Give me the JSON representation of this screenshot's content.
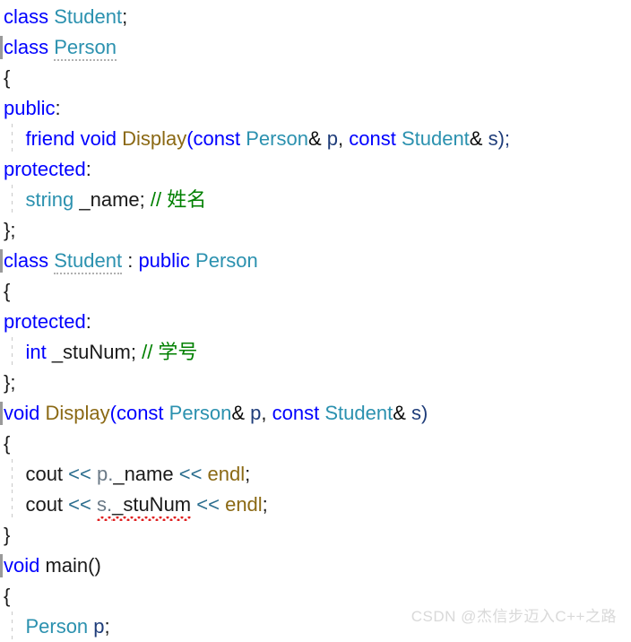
{
  "editor": {
    "language": "C++",
    "background_color": "#ffffff",
    "font_size_px": 22,
    "line_height_px": 34,
    "theme_colors": {
      "keyword": "#0000FF",
      "type": "#2B91AF",
      "function": "#8B6914",
      "comment": "#008000",
      "plain_text": "#1a1a1a",
      "parameter": "#1F3D7A",
      "object_qualifier": "#6b7a87",
      "stream_operator": "#2B6E8F",
      "error_squiggle": "#e02020",
      "indent_guide": "#c9c9c9",
      "margin_marker": "#9a9a9a"
    }
  },
  "code": {
    "lines": [
      {
        "n": 1,
        "marked": false,
        "guide": false,
        "tokens": [
          {
            "t": "class ",
            "c": "kw"
          },
          {
            "t": "Student",
            "c": "typ"
          },
          {
            "t": ";",
            "c": "plain"
          }
        ]
      },
      {
        "n": 2,
        "marked": true,
        "guide": false,
        "tokens": [
          {
            "t": "class ",
            "c": "kw"
          },
          {
            "t": "Person",
            "c": "typ",
            "dotted": true
          }
        ]
      },
      {
        "n": 3,
        "marked": false,
        "guide": false,
        "tokens": [
          {
            "t": "{",
            "c": "plain"
          }
        ]
      },
      {
        "n": 4,
        "marked": false,
        "guide": false,
        "tokens": [
          {
            "t": "public",
            "c": "kw"
          },
          {
            "t": ":",
            "c": "plain"
          }
        ]
      },
      {
        "n": 5,
        "marked": false,
        "guide": true,
        "tokens": [
          {
            "t": "    ",
            "c": "plain"
          },
          {
            "t": "friend void ",
            "c": "kw"
          },
          {
            "t": "Display",
            "c": "fn"
          },
          {
            "t": "(",
            "c": "kw"
          },
          {
            "t": "const ",
            "c": "kw"
          },
          {
            "t": "Person",
            "c": "typ"
          },
          {
            "t": "&",
            "c": "amp"
          },
          {
            "t": " p",
            "c": "var"
          },
          {
            "t": ", ",
            "c": "plain"
          },
          {
            "t": "const ",
            "c": "kw"
          },
          {
            "t": "Student",
            "c": "typ"
          },
          {
            "t": "&",
            "c": "amp"
          },
          {
            "t": " s",
            "c": "var"
          },
          {
            "t": ");",
            "c": "var"
          }
        ]
      },
      {
        "n": 6,
        "marked": false,
        "guide": false,
        "tokens": [
          {
            "t": "protected",
            "c": "kw"
          },
          {
            "t": ":",
            "c": "plain"
          }
        ]
      },
      {
        "n": 7,
        "marked": false,
        "guide": true,
        "tokens": [
          {
            "t": "    ",
            "c": "plain"
          },
          {
            "t": "string",
            "c": "typ"
          },
          {
            "t": " _name; ",
            "c": "plain"
          },
          {
            "t": "// 姓名",
            "c": "cmt"
          }
        ]
      },
      {
        "n": 8,
        "marked": false,
        "guide": false,
        "tokens": [
          {
            "t": "};",
            "c": "plain"
          }
        ]
      },
      {
        "n": 9,
        "marked": true,
        "guide": false,
        "tick": true,
        "tokens": [
          {
            "t": "class ",
            "c": "kw"
          },
          {
            "t": "Student",
            "c": "typ",
            "dotted": true
          },
          {
            "t": " : ",
            "c": "plain"
          },
          {
            "t": "public ",
            "c": "kw"
          },
          {
            "t": "Person",
            "c": "typ"
          }
        ]
      },
      {
        "n": 10,
        "marked": false,
        "guide": false,
        "tokens": [
          {
            "t": "{",
            "c": "plain"
          }
        ]
      },
      {
        "n": 11,
        "marked": false,
        "guide": false,
        "tokens": [
          {
            "t": "protected",
            "c": "kw"
          },
          {
            "t": ":",
            "c": "plain"
          }
        ]
      },
      {
        "n": 12,
        "marked": false,
        "guide": true,
        "tokens": [
          {
            "t": "    ",
            "c": "plain"
          },
          {
            "t": "int",
            "c": "kw"
          },
          {
            "t": " _stuNum; ",
            "c": "plain"
          },
          {
            "t": "// 学号",
            "c": "cmt"
          }
        ]
      },
      {
        "n": 13,
        "marked": false,
        "guide": false,
        "tokens": [
          {
            "t": "};",
            "c": "plain"
          }
        ]
      },
      {
        "n": 14,
        "marked": true,
        "guide": false,
        "tick": true,
        "tokens": [
          {
            "t": "void ",
            "c": "kw"
          },
          {
            "t": "Display",
            "c": "fn"
          },
          {
            "t": "(",
            "c": "kw"
          },
          {
            "t": "const ",
            "c": "kw"
          },
          {
            "t": "Person",
            "c": "typ"
          },
          {
            "t": "&",
            "c": "amp"
          },
          {
            "t": " p",
            "c": "var"
          },
          {
            "t": ", ",
            "c": "plain"
          },
          {
            "t": "const ",
            "c": "kw"
          },
          {
            "t": "Student",
            "c": "typ"
          },
          {
            "t": "&",
            "c": "amp"
          },
          {
            "t": " s",
            "c": "var"
          },
          {
            "t": ")",
            "c": "var"
          }
        ]
      },
      {
        "n": 15,
        "marked": false,
        "guide": false,
        "tokens": [
          {
            "t": "{",
            "c": "plain"
          }
        ]
      },
      {
        "n": 16,
        "marked": false,
        "guide": true,
        "tokens": [
          {
            "t": "    ",
            "c": "plain"
          },
          {
            "t": "cout ",
            "c": "plain"
          },
          {
            "t": "<< ",
            "c": "op"
          },
          {
            "t": "p.",
            "c": "obj"
          },
          {
            "t": "_name ",
            "c": "plain"
          },
          {
            "t": "<< ",
            "c": "op"
          },
          {
            "t": "endl",
            "c": "strm"
          },
          {
            "t": ";",
            "c": "plain"
          }
        ]
      },
      {
        "n": 17,
        "marked": false,
        "guide": true,
        "tokens": [
          {
            "t": "    ",
            "c": "plain"
          },
          {
            "t": "cout ",
            "c": "plain"
          },
          {
            "t": "<< ",
            "c": "op"
          },
          {
            "t": "s.",
            "c": "obj",
            "squiggle": true
          },
          {
            "t": "_stuNum",
            "c": "plain",
            "squiggle": true
          },
          {
            "t": " ",
            "c": "plain"
          },
          {
            "t": "<< ",
            "c": "op"
          },
          {
            "t": "endl",
            "c": "strm"
          },
          {
            "t": ";",
            "c": "plain"
          }
        ]
      },
      {
        "n": 18,
        "marked": false,
        "guide": false,
        "tokens": [
          {
            "t": "}",
            "c": "plain"
          }
        ]
      },
      {
        "n": 19,
        "marked": true,
        "guide": false,
        "tick": true,
        "tokens": [
          {
            "t": "void ",
            "c": "kw"
          },
          {
            "t": "main",
            "c": "plain"
          },
          {
            "t": "()",
            "c": "plain"
          }
        ]
      },
      {
        "n": 20,
        "marked": false,
        "guide": false,
        "tokens": [
          {
            "t": "{",
            "c": "plain"
          }
        ]
      },
      {
        "n": 21,
        "marked": false,
        "guide": true,
        "tokens": [
          {
            "t": "    ",
            "c": "plain"
          },
          {
            "t": "Person",
            "c": "typ"
          },
          {
            "t": " p",
            "c": "var"
          },
          {
            "t": ";",
            "c": "plain"
          }
        ]
      }
    ],
    "plain_source": "class Student;\nclass Person\n{\npublic:\n    friend void Display(const Person& p, const Student& s);\nprotected:\n    string _name; // 姓名\n};\nclass Student : public Person\n{\nprotected:\n    int _stuNum; // 学号\n};\nvoid Display(const Person& p, const Student& s)\n{\n    cout << p._name << endl;\n    cout << s._stuNum << endl;\n}\nvoid main()\n{\n    Person p;"
  },
  "watermark": {
    "text": "CSDN @杰信步迈入C++之路"
  }
}
